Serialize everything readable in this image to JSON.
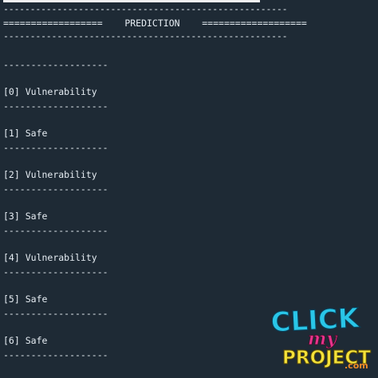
{
  "terminal": {
    "rule_top": "-----------------------------------------------------",
    "header": "==================    PREDICTION    ===================",
    "rule_bottom": "-----------------------------------------------------",
    "separator": "-------------------",
    "predictions": [
      {
        "index": "[0]",
        "label": "Vulnerability"
      },
      {
        "index": "[1]",
        "label": "Safe"
      },
      {
        "index": "[2]",
        "label": "Vulnerability"
      },
      {
        "index": "[3]",
        "label": "Safe"
      },
      {
        "index": "[4]",
        "label": "Vulnerability"
      },
      {
        "index": "[5]",
        "label": "Safe"
      },
      {
        "index": "[6]",
        "label": "Safe"
      }
    ]
  },
  "watermark": {
    "line1": "CLICK",
    "line2": "my",
    "line3": "PROJECT",
    "suffix": ".com"
  },
  "colors": {
    "background": "#1e2a35",
    "text": "#e6edf3",
    "logo_cyan": "#29c6e8",
    "logo_green": "#7bd448",
    "logo_yellow": "#f4e23a",
    "logo_pink": "#e8348d",
    "logo_orange": "#f28c28"
  }
}
